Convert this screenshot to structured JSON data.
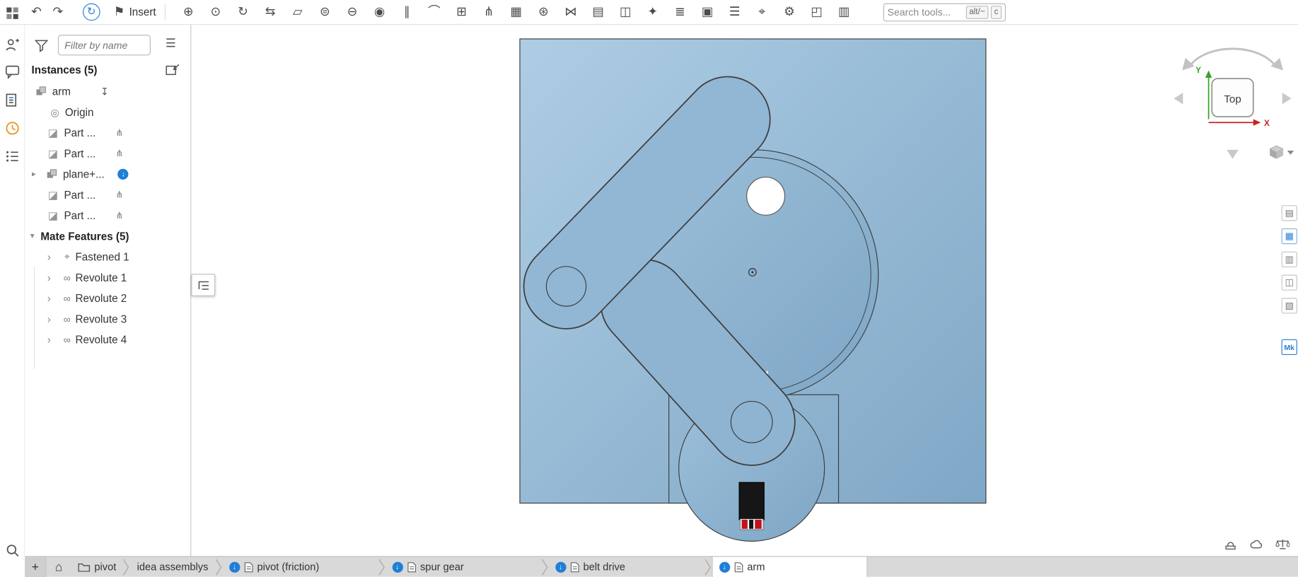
{
  "topbar": {
    "insert_label": "Insert",
    "search_placeholder": "Search tools...",
    "shortcuts": [
      "alt/~",
      "c"
    ],
    "tools": [
      {
        "name": "mate-tool-icon",
        "glyph": "⊕"
      },
      {
        "name": "fastened-mate-icon",
        "glyph": "⊙"
      },
      {
        "name": "revolute-mate-icon",
        "glyph": "↻"
      },
      {
        "name": "slider-mate-icon",
        "glyph": "⇆"
      },
      {
        "name": "planar-mate-icon",
        "glyph": "▱"
      },
      {
        "name": "cylindrical-mate-icon",
        "glyph": "⊜"
      },
      {
        "name": "pin-slot-mate-icon",
        "glyph": "⊖"
      },
      {
        "name": "ball-mate-icon",
        "glyph": "◉"
      },
      {
        "name": "parallel-mate-icon",
        "glyph": "∥"
      },
      {
        "name": "tangent-mate-icon",
        "glyph": "⌒"
      },
      {
        "name": "group-tool-icon",
        "glyph": "⊞"
      },
      {
        "name": "mate-connector-tool-icon",
        "glyph": "⋔"
      },
      {
        "name": "linear-pattern-icon",
        "glyph": "▦"
      },
      {
        "name": "circular-pattern-icon",
        "glyph": "⊛"
      },
      {
        "name": "replicate-icon",
        "glyph": "⋈"
      },
      {
        "name": "standard-content-icon",
        "glyph": "▤"
      },
      {
        "name": "sheet-metal-icon",
        "glyph": "◫"
      },
      {
        "name": "exploded-view-icon",
        "glyph": "✦"
      },
      {
        "name": "named-positions-icon",
        "glyph": "≣"
      },
      {
        "name": "snapshot-tool-icon",
        "glyph": "▣"
      },
      {
        "name": "bom-icon",
        "glyph": "☰"
      },
      {
        "name": "measure-tool-icon",
        "glyph": "⌖"
      },
      {
        "name": "mass-properties-icon",
        "glyph": "⚙"
      },
      {
        "name": "frame-tool-icon",
        "glyph": "◰"
      },
      {
        "name": "drawing-tool-icon",
        "glyph": "▥"
      }
    ]
  },
  "icons": {
    "undo": "↶",
    "redo": "↷",
    "rotate": "↻",
    "insert_flag": "⚑",
    "panel_list": "☰",
    "plus": "+",
    "home": "⌂",
    "origin": "◎",
    "part": "◪",
    "chevron_right": "▸",
    "chevron_down": "▾",
    "chevron_small": "›",
    "mate_connector": "⋔",
    "fixed": "↧",
    "download_arrow": "↓"
  },
  "sidebar": {
    "filter_placeholder": "Filter by name",
    "instances_header": "Instances (5)",
    "instances": {
      "arm": "arm",
      "origin": "Origin",
      "part1": "Part ...",
      "part2": "Part ...",
      "plane": "plane+...",
      "part3": "Part ...",
      "part4": "Part ..."
    },
    "mate_header": "Mate Features (5)",
    "mates": [
      {
        "label": "Fastened 1",
        "icon": "⌖"
      },
      {
        "label": "Revolute 1",
        "icon": "∞"
      },
      {
        "label": "Revolute 2",
        "icon": "∞"
      },
      {
        "label": "Revolute 3",
        "icon": "∞"
      },
      {
        "label": "Revolute 4",
        "icon": "∞"
      }
    ]
  },
  "viewcube": {
    "top_label": "Top",
    "axis_x": "X",
    "axis_y": "Y"
  },
  "right_panel": {
    "items": [
      "▤",
      "▦",
      "▥",
      "◫",
      "▧"
    ],
    "mk_label": "Mk"
  },
  "tabs": {
    "folder_label": "pivot",
    "breadcrumb_label": "idea assemblys",
    "items": [
      {
        "label": "pivot (friction)"
      },
      {
        "label": "spur gear"
      },
      {
        "label": "belt drive"
      },
      {
        "label": "arm"
      }
    ]
  },
  "colors": {
    "part_blue": "#8FB4D1",
    "accent_blue": "#1f7fd6",
    "axis_green": "#3aa32a",
    "axis_red": "#cc2222"
  }
}
